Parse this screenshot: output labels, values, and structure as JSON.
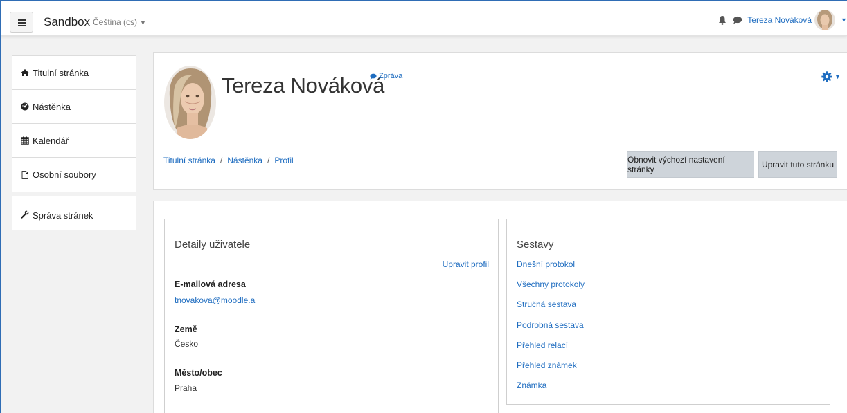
{
  "navbar": {
    "brand": "Sandbox",
    "language": "Čeština (cs)",
    "user_name": "Tereza Nováková"
  },
  "sidebar": {
    "items": [
      {
        "label": "Titulní stránka",
        "icon": "home-icon"
      },
      {
        "label": "Nástěnka",
        "icon": "dashboard-icon"
      },
      {
        "label": "Kalendář",
        "icon": "calendar-icon"
      },
      {
        "label": "Osobní soubory",
        "icon": "file-icon"
      }
    ],
    "admin": {
      "label": "Správa stránek",
      "icon": "wrench-icon"
    }
  },
  "header": {
    "name": "Tereza Nováková",
    "message_link": "Zpráva",
    "breadcrumb": [
      "Titulní stránka",
      "Nástěnka",
      "Profil"
    ],
    "breadcrumb_separator": "/",
    "reset_button": "Obnovit výchozí nastavení stránky",
    "edit_button": "Upravit tuto stránku"
  },
  "details": {
    "title": "Detaily uživatele",
    "edit_profile": "Upravit profil",
    "fields": [
      {
        "label": "E-mailová adresa",
        "value": "tnovakova@moodle.a"
      },
      {
        "label": "Země",
        "value": "Česko"
      },
      {
        "label": "Město/obec",
        "value": "Praha"
      }
    ]
  },
  "reports": {
    "title": "Sestavy",
    "links": [
      "Dnešní protokol",
      "Všechny protokoly",
      "Stručná sestava",
      "Podrobná sestava",
      "Přehled relací",
      "Přehled známek",
      "Známka"
    ]
  },
  "colors": {
    "link": "#1f6dc0",
    "button_bg": "#ced4da",
    "page_bg": "#f2f2f2",
    "frame": "#2f6db5"
  }
}
